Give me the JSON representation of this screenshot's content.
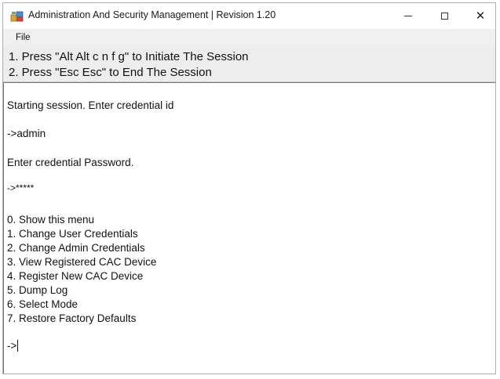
{
  "window": {
    "title": "Administration And Security Management  |  Revision 1.20",
    "icon": "app-icon",
    "controls": {
      "minimize": "minimize-icon",
      "maximize": "maximize-icon",
      "close": "✕"
    }
  },
  "menu": {
    "file": "File"
  },
  "instructions": {
    "line1": "1. Press \"Alt Alt c n f g\" to Initiate The Session",
    "line2": "2. Press \"Esc Esc\" to End The Session"
  },
  "console": {
    "lines": [
      "Starting session. Enter credential id",
      "->admin",
      "Enter credential Password.",
      "->*****",
      "0.  Show this menu",
      "1.  Change User Credentials",
      "2.  Change Admin Credentials",
      "3.  View Registered CAC Device",
      "4.  Register New CAC Device",
      "5.  Dump Log",
      "6.  Select Mode",
      "7.  Restore Factory Defaults"
    ],
    "prompt": "->"
  }
}
